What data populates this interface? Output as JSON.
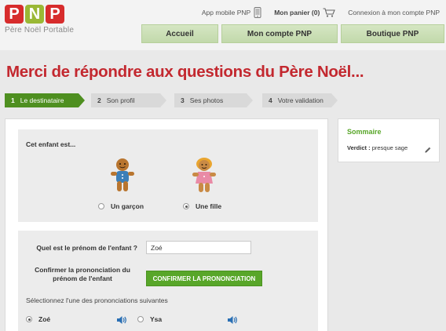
{
  "brand": {
    "letters": [
      "P",
      "N",
      "P"
    ],
    "tagline": "Père Noël Portable"
  },
  "top_links": {
    "app": "App mobile PNP",
    "cart": "Mon panier (0)",
    "login": "Connexion à mon compte PNP"
  },
  "nav": {
    "tabs": [
      {
        "label": "Accueil"
      },
      {
        "label": "Mon compte PNP"
      },
      {
        "label": "Boutique PNP"
      }
    ]
  },
  "page": {
    "title": "Merci de répondre aux questions du Père Noël..."
  },
  "steps": [
    {
      "num": "1",
      "label": "Le destinataire",
      "active": true
    },
    {
      "num": "2",
      "label": "Son profil",
      "active": false
    },
    {
      "num": "3",
      "label": "Ses photos",
      "active": false
    },
    {
      "num": "4",
      "label": "Votre validation",
      "active": false
    }
  ],
  "gender": {
    "question": "Cet enfant est...",
    "options": [
      {
        "label": "Un garçon",
        "selected": false
      },
      {
        "label": "Une fille",
        "selected": true
      }
    ]
  },
  "name_section": {
    "label": "Quel est le prénom de l'enfant ?",
    "value": "Zoé",
    "confirm_label": "Confirmer la prononciation du prénom de l'enfant",
    "confirm_button": "CONFIRMER LA PRONONCIATION",
    "select_label": "Sélectionnez l'une des prononciations suivantes",
    "pronunciations": [
      {
        "label": "Zoé",
        "selected": true
      },
      {
        "label": "Ysa",
        "selected": false
      }
    ]
  },
  "summary": {
    "title": "Sommaire",
    "verdict_key": "Verdict :",
    "verdict_value": "presque sage"
  },
  "colors": {
    "accent_red": "#c3282f",
    "accent_green": "#58a629",
    "step_active": "#4e8f20",
    "nav_tab": "#c9dfb3"
  }
}
